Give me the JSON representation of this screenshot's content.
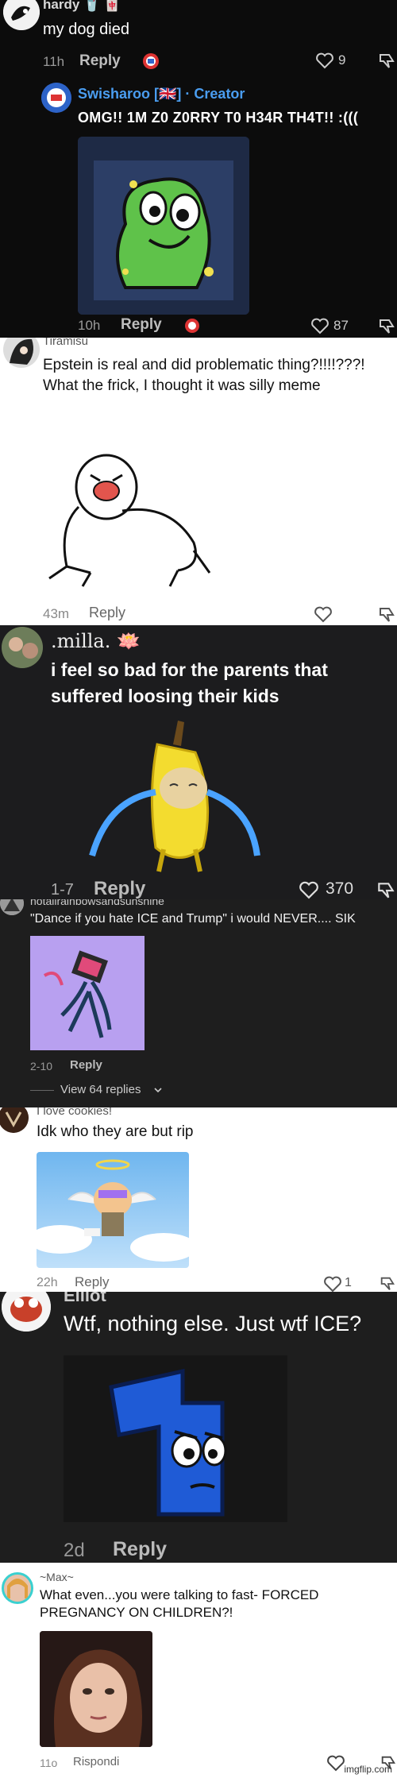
{
  "posts": [
    {
      "username": "hardy 🥤 🀄",
      "comment": "my dog died",
      "time": "11h",
      "reply_label": "Reply",
      "likes": "9",
      "nested": {
        "username": "Swisharoo [🇬🇧] · Creator",
        "comment": "OMG!! 1M Z0 Z0RRY T0 H34R TH4T!! :(((",
        "time": "10h",
        "reply_label": "Reply",
        "likes": "87"
      }
    },
    {
      "username": "Tiramisu",
      "comment": "Epstein is real and did problematic thing?!!!!???! What the frick, I thought it was silly meme",
      "time": "43m",
      "reply_label": "Reply"
    },
    {
      "username": ".milla. 🪷",
      "comment": "i feel so bad for the parents that suffered loosing their kids",
      "time": "1-7",
      "reply_label": "Reply",
      "likes": "370"
    },
    {
      "username": "notallrainbowsandsunshine",
      "comment": "\"Dance if you hate ICE and Trump\" i would NEVER.... SIK",
      "time": "2-10",
      "reply_label": "Reply",
      "view_replies": "View 64 replies"
    },
    {
      "username": "I love cookies!",
      "comment": "Idk who they are but rip",
      "time": "22h",
      "reply_label": "Reply",
      "likes": "1"
    },
    {
      "username": "Elliot",
      "comment": "Wtf, nothing else. Just wtf ICE?",
      "time": "2d",
      "reply_label": "Reply"
    },
    {
      "username": "~Max~",
      "comment": "What even...you were talking to fast- FORCED PREGNANCY ON CHILDREN?!",
      "time": "11o",
      "reply_label": "Rispondi"
    }
  ],
  "watermark": "imgflip.com",
  "colors": {
    "creator_blue": "#4a9df0",
    "dark_panel": "#1e1e1e",
    "light_panel": "#ffffff"
  },
  "icons": [
    "heart-icon",
    "dislike-icon",
    "chevron-down-icon"
  ]
}
